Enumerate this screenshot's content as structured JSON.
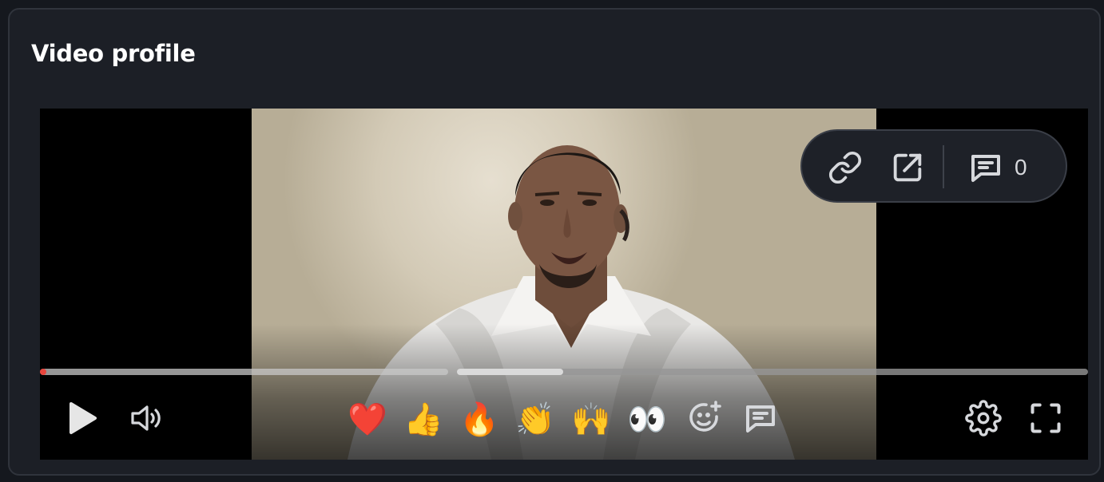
{
  "card": {
    "title": "Video profile"
  },
  "overlay": {
    "comment_count": "0",
    "icons": [
      "link-icon",
      "external-link-icon",
      "comment-icon"
    ]
  },
  "player": {
    "progress_played_fraction": 0.005,
    "progress_buffered_fraction": 0.5,
    "accent_color": "#e8453c",
    "controls": [
      "play-icon",
      "volume-icon",
      "settings-gear-icon",
      "fullscreen-icon"
    ],
    "reactions": [
      {
        "name": "heart",
        "glyph": "❤️"
      },
      {
        "name": "thumbs-up",
        "glyph": "👍"
      },
      {
        "name": "fire",
        "glyph": "🔥"
      },
      {
        "name": "clapping-hands",
        "glyph": "👏"
      },
      {
        "name": "raising-hands",
        "glyph": "🙌"
      },
      {
        "name": "eyes",
        "glyph": "👀"
      }
    ],
    "extra_actions": [
      "add-reaction-icon",
      "comment-icon"
    ]
  }
}
